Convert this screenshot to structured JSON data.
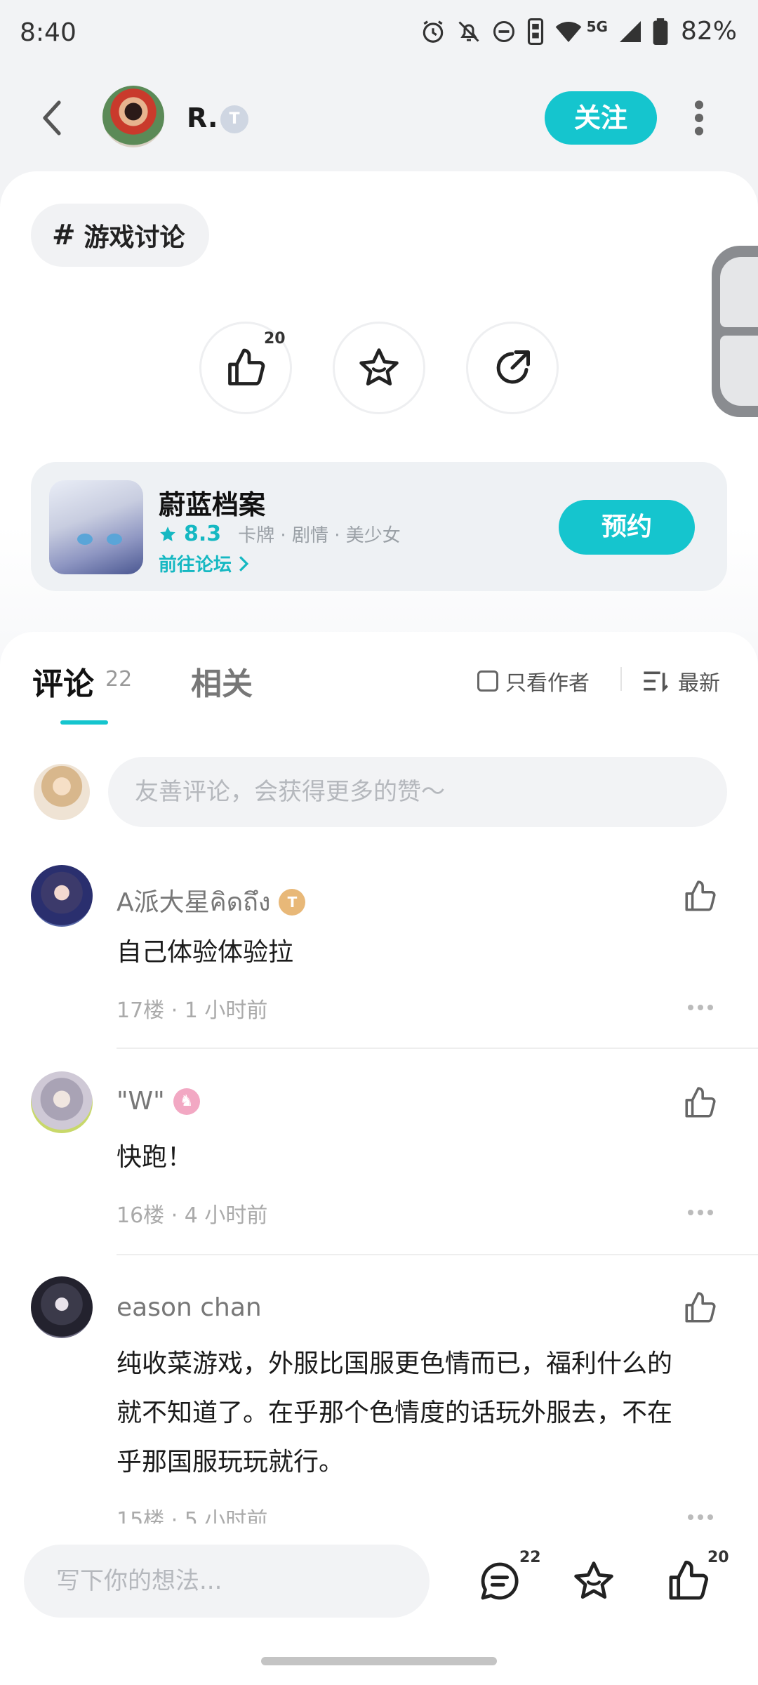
{
  "status_bar": {
    "time": "8:40",
    "network": "5G",
    "battery": "82%",
    "icons": [
      "alarm-icon",
      "bell-off-icon",
      "dnd-icon",
      "vibrate-icon",
      "wifi-icon",
      "signal-icon",
      "battery-icon"
    ]
  },
  "header": {
    "author_name": "R.",
    "author_badge": "T",
    "follow_label": "关注"
  },
  "post": {
    "topic_tag": "游戏讨论",
    "like_count": "20"
  },
  "game": {
    "title": "蔚蓝档案",
    "rating": "8.3",
    "tags": "卡牌 · 剧情 · 美少女",
    "forum_link": "前往论坛",
    "reserve_label": "预约"
  },
  "comments_section": {
    "tab_comments": "评论",
    "tab_comments_count": "22",
    "tab_related": "相关",
    "only_author": "只看作者",
    "sort": "最新",
    "input_placeholder": "友善评论，会获得更多的赞～"
  },
  "comments": [
    {
      "name": "A派大星คิดถึง",
      "badge": "T",
      "text": "自己体验体验拉",
      "meta": "17楼 · 1 小时前"
    },
    {
      "name": "\"W\"",
      "badge": "♞",
      "text": "快跑！",
      "meta": "16楼 · 4 小时前"
    },
    {
      "name": "eason chan",
      "badge": "",
      "text_lines": [
        "纯收菜游戏，外服比国服更色情而已，福利什么的",
        "就不知道了。在乎那个色情度的话玩外服去，不在",
        "乎那国服玩玩就行。"
      ],
      "meta": "15楼 · 5 小时前"
    }
  ],
  "bottom_bar": {
    "input_placeholder": "写下你的想法...",
    "comment_count": "22",
    "like_count": "20"
  },
  "colors": {
    "accent": "#15c5ce",
    "accent_text": "#15b8c2",
    "background": "#f2f3f5"
  }
}
